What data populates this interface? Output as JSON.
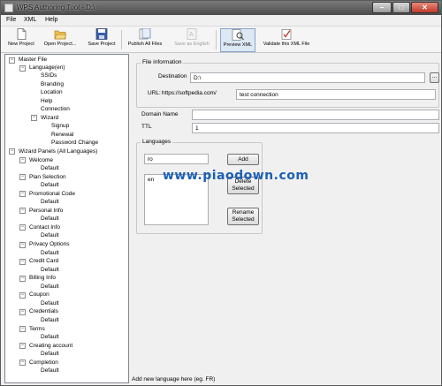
{
  "window": {
    "title": "WPS Authoring Tool - D:\\"
  },
  "menu": [
    "File",
    "XML",
    "Help"
  ],
  "toolbar": {
    "new_project": "New Project",
    "open_project": "Open Project...",
    "save_project": "Save Project",
    "publish_all": "Publish All Files",
    "save_as_english": "Save as English",
    "preview_xml": "Preview XML",
    "validate_xml": "Validate this XML File"
  },
  "tree": {
    "master_file": "Master File",
    "language": "Language(en)",
    "language_children": [
      "SSIDs",
      "Branding",
      "Location",
      "Help",
      "Connection"
    ],
    "wizard": "Wizard",
    "wizard_children": [
      "Signup",
      "Renewal",
      "Password Change"
    ],
    "wizard_panels": "Wizard Panels (All Languages)",
    "panels": [
      {
        "name": "Welcome",
        "child": "Default"
      },
      {
        "name": "Plan Selection",
        "child": "Default"
      },
      {
        "name": "Promotional Code",
        "child": "Default"
      },
      {
        "name": "Personal Info",
        "child": "Default"
      },
      {
        "name": "Contact Info",
        "child": "Default"
      },
      {
        "name": "Privacy Options",
        "child": "Default"
      },
      {
        "name": "Credit Card",
        "child": "Default"
      },
      {
        "name": "Billing Info",
        "child": "Default"
      },
      {
        "name": "Coupon",
        "child": "Default"
      },
      {
        "name": "Credentials",
        "child": "Default"
      },
      {
        "name": "Terms",
        "child": "Default"
      },
      {
        "name": "Creating account",
        "child": "Default"
      },
      {
        "name": "Completion",
        "child": "Default"
      }
    ]
  },
  "file_info": {
    "group_title": "File information",
    "destination_label": "Destination",
    "destination_value": "D:\\",
    "browse_label": "...",
    "url_label": "URL:",
    "url_value": "https://softpedia.com/",
    "test_connection_value": "test connection"
  },
  "domain": {
    "label": "Domain Name",
    "value": ""
  },
  "ttl": {
    "label": "TTL",
    "value": "1"
  },
  "languages": {
    "group_title": "Languages",
    "new_value": "ro",
    "add_label": "Add",
    "items": [
      "en"
    ],
    "delete_label_1": "Delete",
    "delete_label_2": "Selected",
    "rename_label_1": "Rename",
    "rename_label_2": "Selected"
  },
  "watermark": "www.piaodown.com",
  "status": "Add new language here (eg. FR)"
}
